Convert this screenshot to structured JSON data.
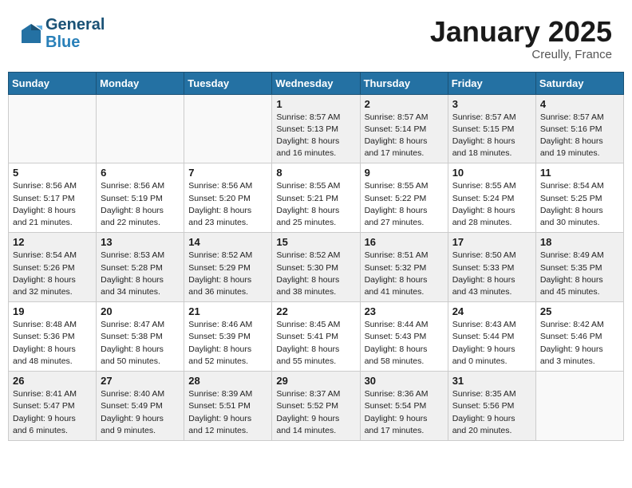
{
  "logo": {
    "line1": "General",
    "line2": "Blue"
  },
  "title": {
    "month_year": "January 2025",
    "location": "Creully, France"
  },
  "days_of_week": [
    "Sunday",
    "Monday",
    "Tuesday",
    "Wednesday",
    "Thursday",
    "Friday",
    "Saturday"
  ],
  "weeks": [
    [
      {
        "day": "",
        "info": ""
      },
      {
        "day": "",
        "info": ""
      },
      {
        "day": "",
        "info": ""
      },
      {
        "day": "1",
        "info": "Sunrise: 8:57 AM\nSunset: 5:13 PM\nDaylight: 8 hours\nand 16 minutes."
      },
      {
        "day": "2",
        "info": "Sunrise: 8:57 AM\nSunset: 5:14 PM\nDaylight: 8 hours\nand 17 minutes."
      },
      {
        "day": "3",
        "info": "Sunrise: 8:57 AM\nSunset: 5:15 PM\nDaylight: 8 hours\nand 18 minutes."
      },
      {
        "day": "4",
        "info": "Sunrise: 8:57 AM\nSunset: 5:16 PM\nDaylight: 8 hours\nand 19 minutes."
      }
    ],
    [
      {
        "day": "5",
        "info": "Sunrise: 8:56 AM\nSunset: 5:17 PM\nDaylight: 8 hours\nand 21 minutes."
      },
      {
        "day": "6",
        "info": "Sunrise: 8:56 AM\nSunset: 5:19 PM\nDaylight: 8 hours\nand 22 minutes."
      },
      {
        "day": "7",
        "info": "Sunrise: 8:56 AM\nSunset: 5:20 PM\nDaylight: 8 hours\nand 23 minutes."
      },
      {
        "day": "8",
        "info": "Sunrise: 8:55 AM\nSunset: 5:21 PM\nDaylight: 8 hours\nand 25 minutes."
      },
      {
        "day": "9",
        "info": "Sunrise: 8:55 AM\nSunset: 5:22 PM\nDaylight: 8 hours\nand 27 minutes."
      },
      {
        "day": "10",
        "info": "Sunrise: 8:55 AM\nSunset: 5:24 PM\nDaylight: 8 hours\nand 28 minutes."
      },
      {
        "day": "11",
        "info": "Sunrise: 8:54 AM\nSunset: 5:25 PM\nDaylight: 8 hours\nand 30 minutes."
      }
    ],
    [
      {
        "day": "12",
        "info": "Sunrise: 8:54 AM\nSunset: 5:26 PM\nDaylight: 8 hours\nand 32 minutes."
      },
      {
        "day": "13",
        "info": "Sunrise: 8:53 AM\nSunset: 5:28 PM\nDaylight: 8 hours\nand 34 minutes."
      },
      {
        "day": "14",
        "info": "Sunrise: 8:52 AM\nSunset: 5:29 PM\nDaylight: 8 hours\nand 36 minutes."
      },
      {
        "day": "15",
        "info": "Sunrise: 8:52 AM\nSunset: 5:30 PM\nDaylight: 8 hours\nand 38 minutes."
      },
      {
        "day": "16",
        "info": "Sunrise: 8:51 AM\nSunset: 5:32 PM\nDaylight: 8 hours\nand 41 minutes."
      },
      {
        "day": "17",
        "info": "Sunrise: 8:50 AM\nSunset: 5:33 PM\nDaylight: 8 hours\nand 43 minutes."
      },
      {
        "day": "18",
        "info": "Sunrise: 8:49 AM\nSunset: 5:35 PM\nDaylight: 8 hours\nand 45 minutes."
      }
    ],
    [
      {
        "day": "19",
        "info": "Sunrise: 8:48 AM\nSunset: 5:36 PM\nDaylight: 8 hours\nand 48 minutes."
      },
      {
        "day": "20",
        "info": "Sunrise: 8:47 AM\nSunset: 5:38 PM\nDaylight: 8 hours\nand 50 minutes."
      },
      {
        "day": "21",
        "info": "Sunrise: 8:46 AM\nSunset: 5:39 PM\nDaylight: 8 hours\nand 52 minutes."
      },
      {
        "day": "22",
        "info": "Sunrise: 8:45 AM\nSunset: 5:41 PM\nDaylight: 8 hours\nand 55 minutes."
      },
      {
        "day": "23",
        "info": "Sunrise: 8:44 AM\nSunset: 5:43 PM\nDaylight: 8 hours\nand 58 minutes."
      },
      {
        "day": "24",
        "info": "Sunrise: 8:43 AM\nSunset: 5:44 PM\nDaylight: 9 hours\nand 0 minutes."
      },
      {
        "day": "25",
        "info": "Sunrise: 8:42 AM\nSunset: 5:46 PM\nDaylight: 9 hours\nand 3 minutes."
      }
    ],
    [
      {
        "day": "26",
        "info": "Sunrise: 8:41 AM\nSunset: 5:47 PM\nDaylight: 9 hours\nand 6 minutes."
      },
      {
        "day": "27",
        "info": "Sunrise: 8:40 AM\nSunset: 5:49 PM\nDaylight: 9 hours\nand 9 minutes."
      },
      {
        "day": "28",
        "info": "Sunrise: 8:39 AM\nSunset: 5:51 PM\nDaylight: 9 hours\nand 12 minutes."
      },
      {
        "day": "29",
        "info": "Sunrise: 8:37 AM\nSunset: 5:52 PM\nDaylight: 9 hours\nand 14 minutes."
      },
      {
        "day": "30",
        "info": "Sunrise: 8:36 AM\nSunset: 5:54 PM\nDaylight: 9 hours\nand 17 minutes."
      },
      {
        "day": "31",
        "info": "Sunrise: 8:35 AM\nSunset: 5:56 PM\nDaylight: 9 hours\nand 20 minutes."
      },
      {
        "day": "",
        "info": ""
      }
    ]
  ]
}
